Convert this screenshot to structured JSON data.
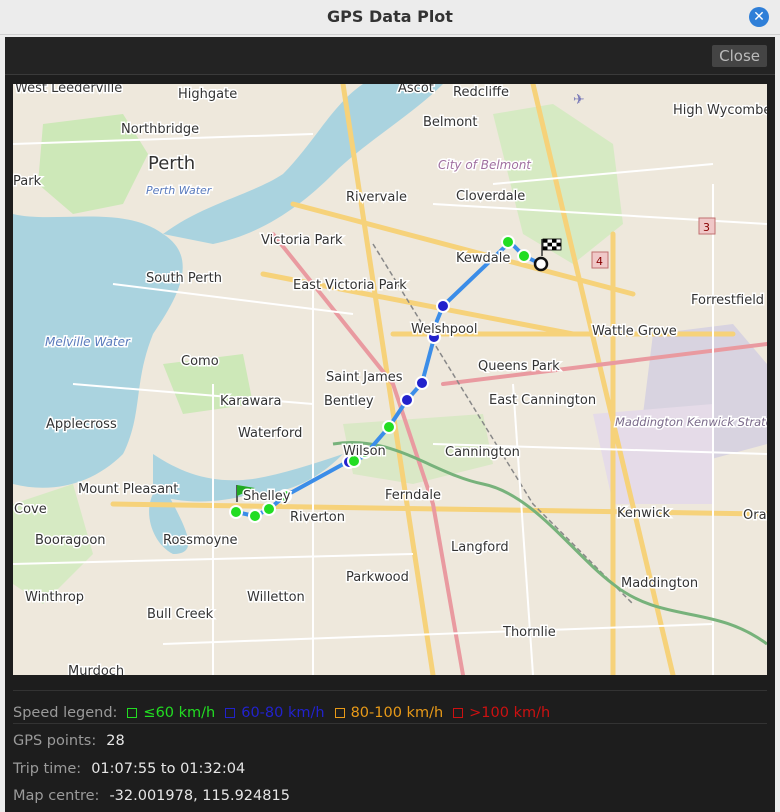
{
  "window": {
    "title": "GPS Data Plot"
  },
  "toolbar": {
    "close_label": "Close"
  },
  "map": {
    "places": [
      {
        "name": "West Leederville"
      },
      {
        "name": "Highgate"
      },
      {
        "name": "Northbridge"
      },
      {
        "name": "Perth"
      },
      {
        "name": "Park"
      },
      {
        "name": "Perth Water"
      },
      {
        "name": "Ascot"
      },
      {
        "name": "Redcliffe"
      },
      {
        "name": "Belmont"
      },
      {
        "name": "City of Belmont"
      },
      {
        "name": "High Wycombe"
      },
      {
        "name": "Rivervale"
      },
      {
        "name": "Cloverdale"
      },
      {
        "name": "Victoria Park"
      },
      {
        "name": "Kewdale"
      },
      {
        "name": "South Perth"
      },
      {
        "name": "East Victoria Park"
      },
      {
        "name": "Forrestfield"
      },
      {
        "name": "Welshpool"
      },
      {
        "name": "Wattle Grove"
      },
      {
        "name": "Melville Water"
      },
      {
        "name": "Como"
      },
      {
        "name": "Queens Park"
      },
      {
        "name": "Saint James"
      },
      {
        "name": "Karawara"
      },
      {
        "name": "Bentley"
      },
      {
        "name": "East Cannington"
      },
      {
        "name": "Applecross"
      },
      {
        "name": "Waterford"
      },
      {
        "name": "Maddington Kenwick Strategic Employment Area"
      },
      {
        "name": "Wilson"
      },
      {
        "name": "Cannington"
      },
      {
        "name": "Mount Pleasant"
      },
      {
        "name": "Shelley"
      },
      {
        "name": "Ferndale"
      },
      {
        "name": "Cove"
      },
      {
        "name": "Riverton"
      },
      {
        "name": "Kenwick"
      },
      {
        "name": "Ora"
      },
      {
        "name": "Booragoon"
      },
      {
        "name": "Rossmoyne"
      },
      {
        "name": "Langford"
      },
      {
        "name": "Parkwood"
      },
      {
        "name": "Winthrop"
      },
      {
        "name": "Willetton"
      },
      {
        "name": "Maddington"
      },
      {
        "name": "Bull Creek"
      },
      {
        "name": "Thornlie"
      },
      {
        "name": "Murdoch"
      }
    ],
    "route_color": "#3b8de8",
    "start_marker": "flag-icon",
    "end_marker": "checkered-flag-icon"
  },
  "legend": {
    "title": "Speed legend:",
    "items": [
      {
        "label": "≤60 km/h",
        "color": "#22dd22"
      },
      {
        "label": "60-80 km/h",
        "color": "#2222cc"
      },
      {
        "label": "80-100 km/h",
        "color": "#e89a18"
      },
      {
        "label": ">100 km/h",
        "color": "#cc1111"
      }
    ]
  },
  "info": {
    "gps_points_label": "GPS points:",
    "gps_points_value": "28",
    "trip_time_label": "Trip time:",
    "trip_time_value": "01:07:55 to 01:32:04",
    "map_centre_label": "Map centre:",
    "map_centre_value": "-32.001978, 115.924815"
  }
}
